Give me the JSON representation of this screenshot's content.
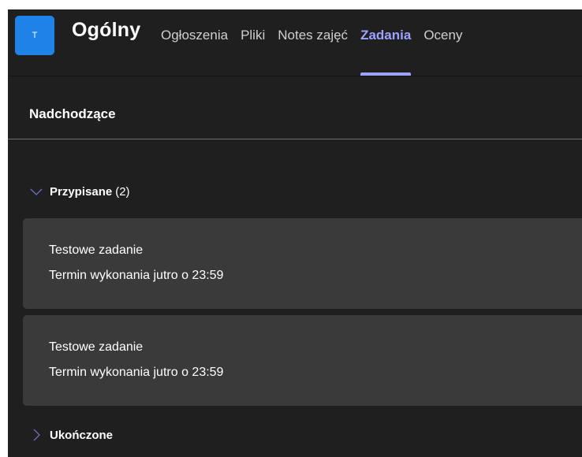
{
  "channel": {
    "avatar_letter": "T",
    "avatar_color": "#1e82e9",
    "title": "Ogólny"
  },
  "tabs": [
    {
      "label": "Ogłoszenia",
      "active": false
    },
    {
      "label": "Pliki",
      "active": false
    },
    {
      "label": "Notes zajęć",
      "active": false
    },
    {
      "label": "Zadania",
      "active": true
    },
    {
      "label": "Oceny",
      "active": false
    }
  ],
  "accent_color": "#9ea2ff",
  "section": {
    "title": "Nadchodzące"
  },
  "groups": {
    "assigned": {
      "label": "Przypisane",
      "count": "(2)",
      "expanded": true,
      "icon": "chevron-down-icon"
    },
    "completed": {
      "label": "Ukończone",
      "expanded": false,
      "icon": "chevron-right-icon"
    }
  },
  "assignments": [
    {
      "name": "Testowe zadanie",
      "due": "Termin wykonania jutro o 23:59"
    },
    {
      "name": "Testowe zadanie",
      "due": "Termin wykonania jutro o 23:59"
    }
  ]
}
